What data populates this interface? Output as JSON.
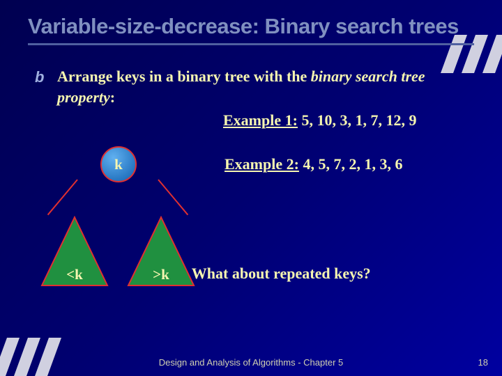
{
  "title": "Variable-size-decrease: Binary search trees",
  "body": {
    "prefix": "Arrange keys in a binary tree with the ",
    "italic": "binary search tree property",
    "suffix": ":"
  },
  "example1": {
    "label": "Example 1:",
    "values": " 5, 10, 3, 1, 7, 12, 9"
  },
  "example2": {
    "label": "Example 2:",
    "values": " 4, 5, 7, 2, 1, 3, 6"
  },
  "question": "• What about repeated keys?",
  "diagram": {
    "root": "k",
    "left": "<k",
    "right": ">k"
  },
  "footer": "Design and Analysis of Algorithms - Chapter 5",
  "page": "18"
}
